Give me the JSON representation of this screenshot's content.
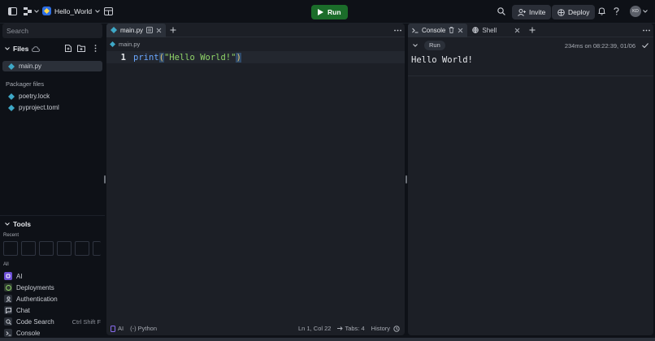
{
  "topbar": {
    "project_name": "Hello_World",
    "run_label": "Run",
    "invite_label": "Invite",
    "deploy_label": "Deploy",
    "avatar_initials": "KD"
  },
  "sidebar": {
    "search_placeholder": "Search",
    "files_title": "Files",
    "files": [
      {
        "name": "main.py"
      }
    ],
    "packager_title": "Packager files",
    "packager_files": [
      {
        "name": "poetry.lock"
      },
      {
        "name": "pyproject.toml"
      }
    ],
    "tools_title": "Tools",
    "recent_label": "Recent",
    "all_label": "All",
    "tools": [
      {
        "label": "AI",
        "shortcut": ""
      },
      {
        "label": "Deployments",
        "shortcut": ""
      },
      {
        "label": "Authentication",
        "shortcut": ""
      },
      {
        "label": "Chat",
        "shortcut": ""
      },
      {
        "label": "Code Search",
        "shortcut": "Ctrl Shift F"
      },
      {
        "label": "Console",
        "shortcut": ""
      }
    ]
  },
  "editor": {
    "tab_label": "main.py",
    "breadcrumb": "main.py",
    "line_number": "1",
    "code": {
      "fn": "print",
      "open": "(",
      "str": "\"Hello World!\"",
      "close": ")"
    },
    "status": {
      "ai": "AI",
      "lang": "(-) Python",
      "position": "Ln 1, Col 22",
      "tabs": "Tabs: 4",
      "history": "History"
    }
  },
  "console": {
    "tab_console": "Console",
    "tab_shell": "Shell",
    "run_label": "Run",
    "timing": "234ms on 08:22:39, 01/06",
    "output": "Hello World!"
  },
  "colors": {
    "accent_green": "#1b6d2a",
    "code_fn": "#6aa7ff",
    "code_str": "#8fd468",
    "code_paren": "#e6c46a"
  }
}
